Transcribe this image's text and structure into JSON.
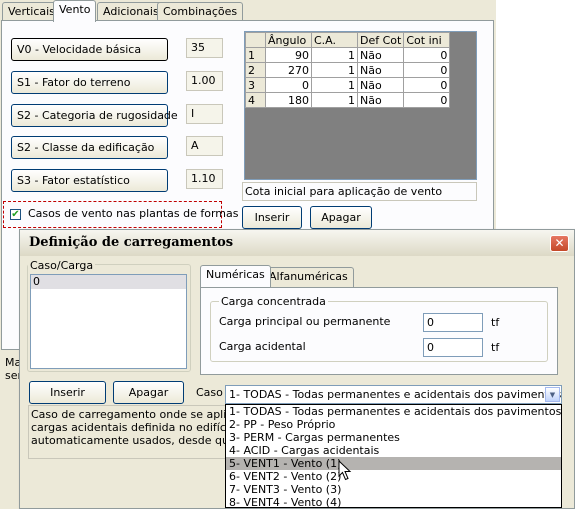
{
  "background_dialog": {
    "tabs": [
      "Verticais",
      "Vento",
      "Adicionais",
      "Combinações"
    ],
    "active_tab": "Vento",
    "factors": [
      {
        "label": "V0 - Velocidade básica",
        "value": "35"
      },
      {
        "label": "S1 - Fator do terreno",
        "value": "1.00"
      },
      {
        "label": "S2 - Categoria de rugosidade",
        "value": "I"
      },
      {
        "label": "S2 - Classe da edificação",
        "value": "A"
      },
      {
        "label": "S3 - Fator estatístico",
        "value": "1.10"
      }
    ],
    "checkbox": {
      "label": "Casos de vento nas plantas de formas",
      "checked": true,
      "mark": "✔"
    },
    "grid": {
      "headers": [
        "",
        "Ângulo",
        "C.A.",
        "Def Cot",
        "Cot ini"
      ],
      "rows": [
        [
          "1",
          "90",
          "1",
          "Não",
          "0"
        ],
        [
          "2",
          "270",
          "1",
          "Não",
          "0"
        ],
        [
          "3",
          "0",
          "1",
          "Não",
          "0"
        ],
        [
          "4",
          "180",
          "1",
          "Não",
          "0"
        ]
      ]
    },
    "status_text": "Cota inicial para aplicação de vento",
    "insert_label": "Inserir",
    "delete_label": "Apagar",
    "left_edge_text": [
      "Ma",
      "ser"
    ]
  },
  "dialog": {
    "title": "Definição de carregamentos",
    "close_glyph": "✕",
    "case_group_label": "Caso/Carga",
    "case_list": [
      "0"
    ],
    "tabs": [
      "Numéricas",
      "Alfanuméricas"
    ],
    "active_tab": "Numéricas",
    "concentrated_group_label": "Carga concentrada",
    "fields": [
      {
        "label": "Carga principal ou permanente",
        "value": "0",
        "unit": "tf"
      },
      {
        "label": "Carga acidental",
        "value": "0",
        "unit": "tf"
      }
    ],
    "insert_label": "Inserir",
    "delete_label": "Apagar",
    "case_label": "Caso",
    "case_selected": "1- TODAS - Todas permanentes e acidentais dos pavimentos",
    "case_options": [
      "1- TODAS - Todas permanentes e acidentais dos pavimentos",
      "2- PP - Peso Próprio",
      "3- PERM - Cargas permanentes",
      "4- ACID - Cargas acidentais",
      "5- VENT1 - Vento (1)",
      "6- VENT2 - Vento (2)",
      "7- VENT3 - Vento (3)",
      "8- VENT4 - Vento (4)"
    ],
    "highlighted_option_index": 4,
    "info_lines": [
      "Caso de carregamento onde se aplica es",
      "cargas acidentais definida no edifício, os",
      "automaticamente usados, desde que voc"
    ]
  },
  "colors": {
    "window_face": "#ece9d8",
    "tab_page": "#fcfcfe",
    "highlight_border": "#c00000",
    "close_button": "#c44828"
  }
}
